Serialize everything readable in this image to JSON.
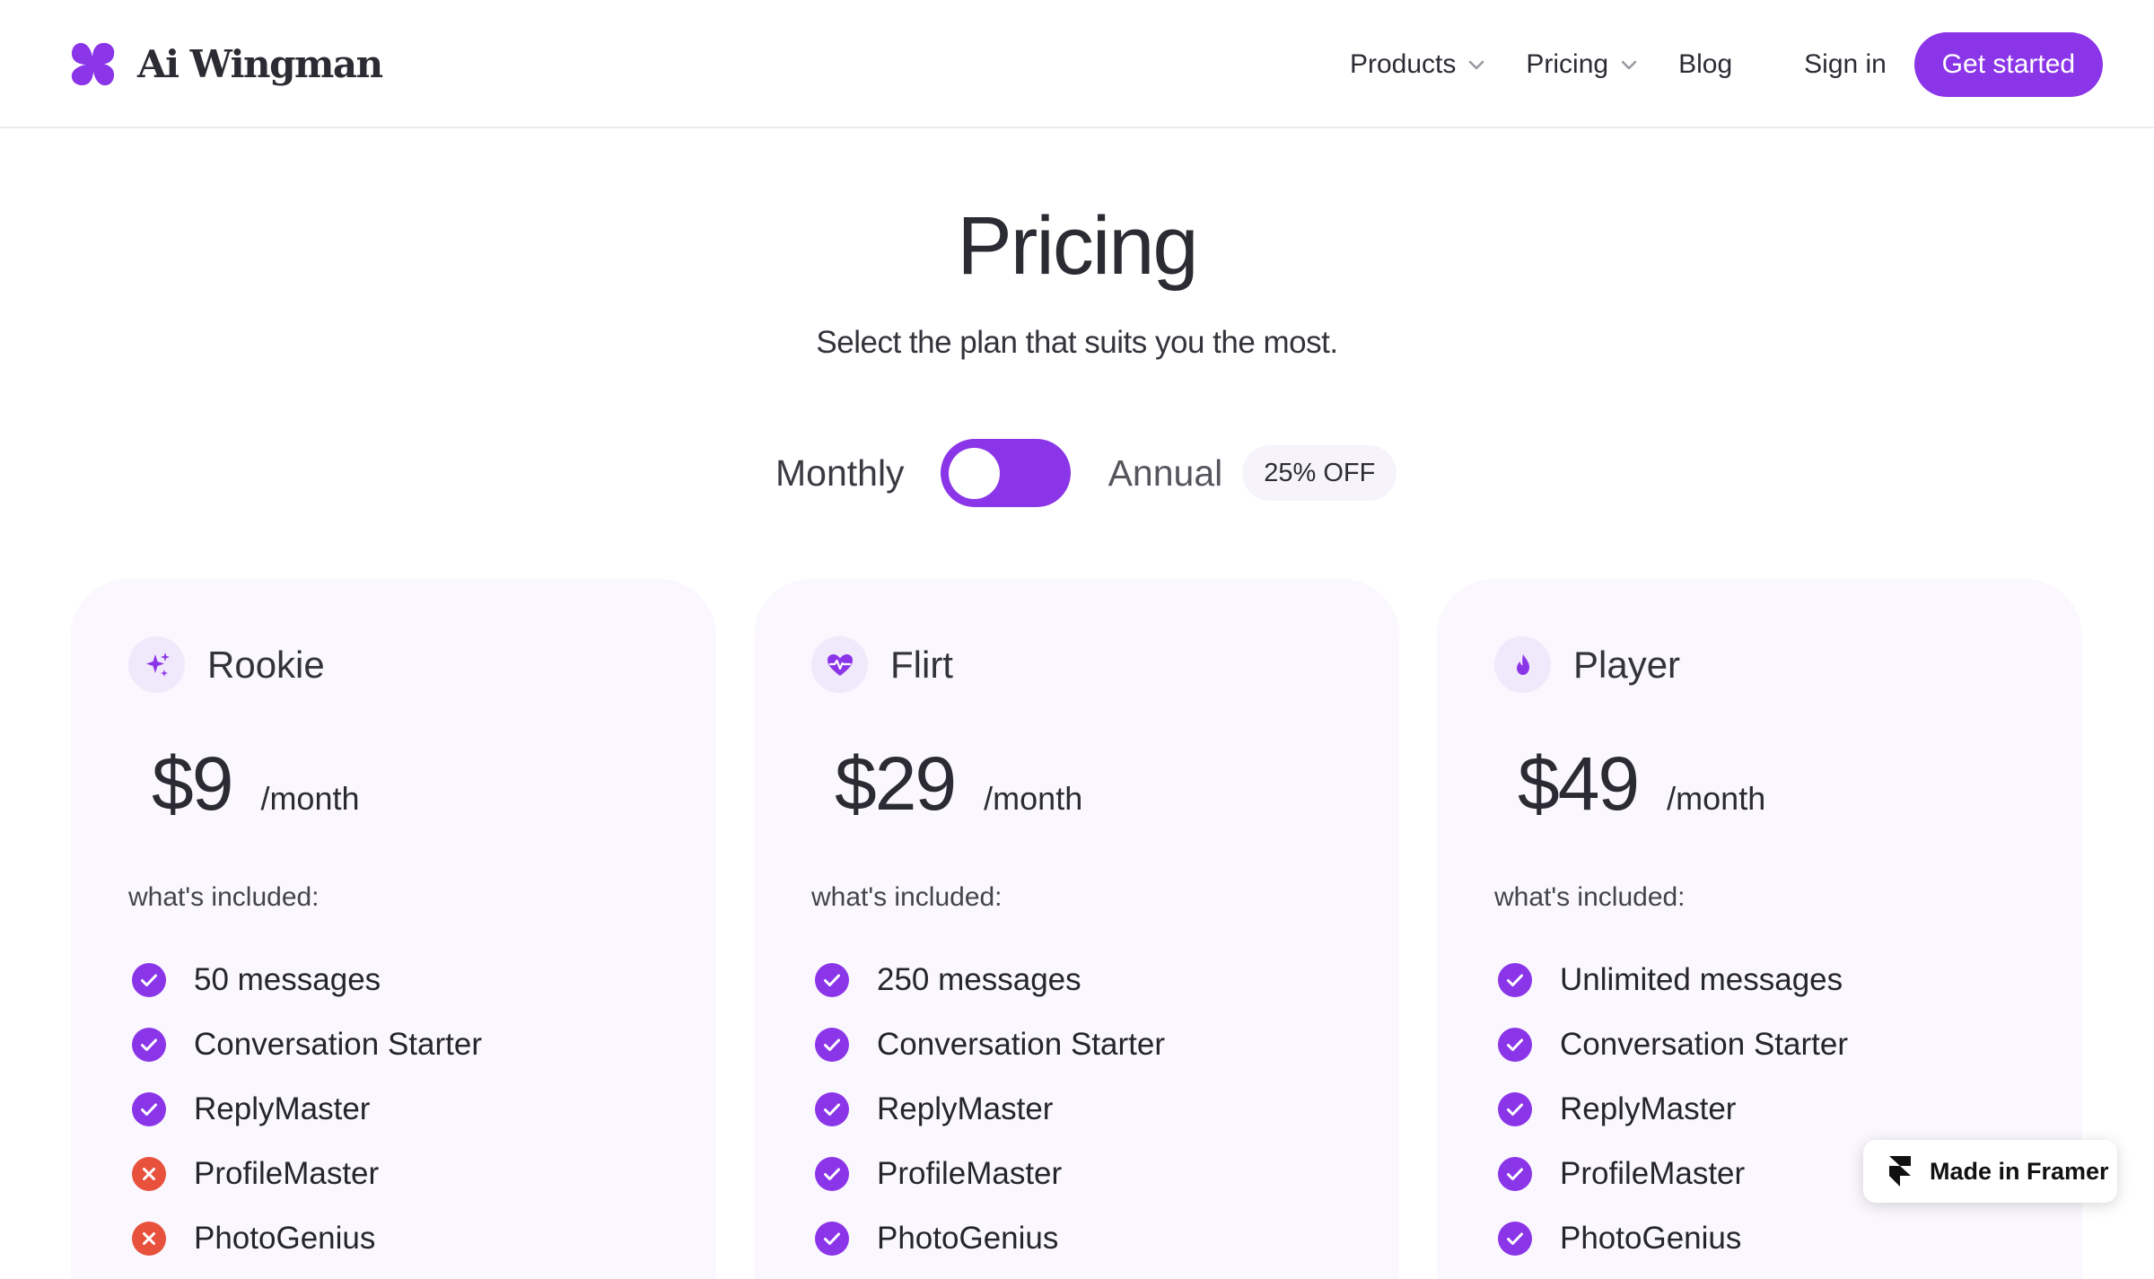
{
  "colors": {
    "accent": "#8b35e8",
    "card_bg": "#faf7fe",
    "icon_bg": "#f0e8fb",
    "excluded": "#e8513c"
  },
  "header": {
    "logo_text": "Ai Wingman",
    "nav": [
      {
        "label": "Products",
        "icon": "chevron-down-icon"
      },
      {
        "label": "Pricing",
        "icon": "chevron-down-icon"
      },
      {
        "label": "Blog"
      }
    ],
    "signin_label": "Sign in",
    "cta_label": "Get started"
  },
  "hero": {
    "title": "Pricing",
    "subtitle": "Select the plan that suits you the most."
  },
  "billing": {
    "monthly_label": "Monthly",
    "annual_label": "Annual",
    "discount_badge": "25% OFF",
    "selected": "monthly"
  },
  "plans": [
    {
      "name": "Rookie",
      "icon": "sparkles-icon",
      "price": "$9",
      "period": "/month",
      "included_label": "what's included:",
      "features": [
        {
          "label": "50 messages",
          "included": true
        },
        {
          "label": "Conversation Starter",
          "included": true
        },
        {
          "label": "ReplyMaster",
          "included": true
        },
        {
          "label": "ProfileMaster",
          "included": false
        },
        {
          "label": "PhotoGenius",
          "included": false
        }
      ]
    },
    {
      "name": "Flirt",
      "icon": "heart-pulse-icon",
      "price": "$29",
      "period": "/month",
      "included_label": "what's included:",
      "features": [
        {
          "label": "250 messages",
          "included": true
        },
        {
          "label": "Conversation Starter",
          "included": true
        },
        {
          "label": "ReplyMaster",
          "included": true
        },
        {
          "label": "ProfileMaster",
          "included": true
        },
        {
          "label": "PhotoGenius",
          "included": true
        }
      ]
    },
    {
      "name": "Player",
      "icon": "flame-icon",
      "price": "$49",
      "period": "/month",
      "included_label": "what's included:",
      "features": [
        {
          "label": "Unlimited messages",
          "included": true
        },
        {
          "label": "Conversation Starter",
          "included": true
        },
        {
          "label": "ReplyMaster",
          "included": true
        },
        {
          "label": "ProfileMaster",
          "included": true
        },
        {
          "label": "PhotoGenius",
          "included": true
        }
      ]
    }
  ],
  "framer_badge": {
    "label": "Made in Framer",
    "icon": "framer-logo-icon"
  }
}
